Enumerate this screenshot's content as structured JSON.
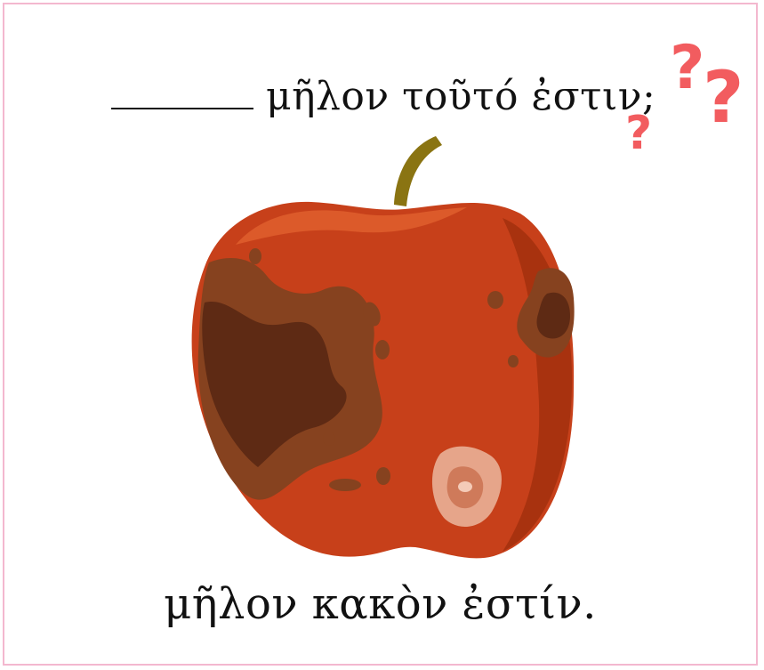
{
  "question": {
    "blank": "",
    "text": "μῆλον τοῦτό ἐστιν;"
  },
  "answer": {
    "text": "μῆλον κακὸν ἐστίν."
  },
  "icons": {
    "question_marks": "question-mark-icon",
    "apple": "rotten-apple-icon"
  },
  "colors": {
    "frame": "#f3b8cf",
    "question_mark": "#f25c5f",
    "apple_body": "#c7401a",
    "apple_highlight": "#dc5a2a",
    "rot_outer": "#86421f",
    "rot_inner": "#5e2a14",
    "stem": "#8a7412",
    "bite_spot": "#e6a58a"
  }
}
